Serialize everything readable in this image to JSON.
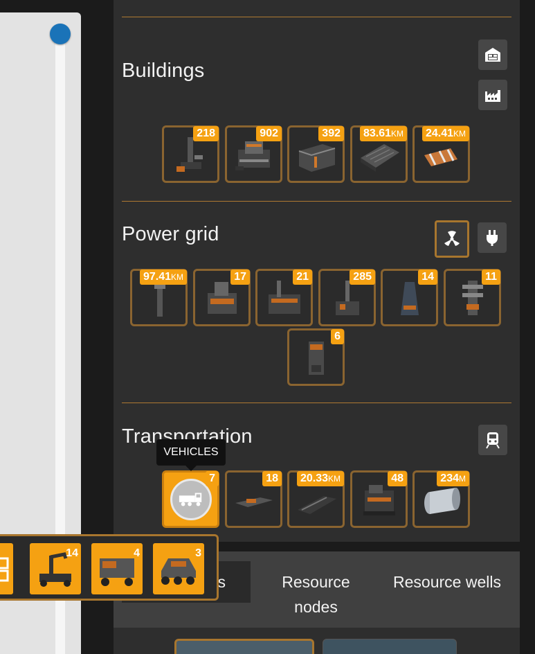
{
  "buildings": {
    "title": "Buildings",
    "icons": [
      "storage-building-icon",
      "factory-icon"
    ],
    "items": [
      {
        "name": "building-item-1",
        "count": "218",
        "unit": ""
      },
      {
        "name": "building-item-2",
        "count": "902",
        "unit": ""
      },
      {
        "name": "building-item-3",
        "count": "392",
        "unit": ""
      },
      {
        "name": "building-item-4",
        "count": "83.61",
        "unit": "KM"
      },
      {
        "name": "building-item-5",
        "count": "24.41",
        "unit": "KM"
      }
    ]
  },
  "power_grid": {
    "title": "Power grid",
    "icons": [
      "radiation-icon",
      "power-plug-icon"
    ],
    "items": [
      {
        "count": "97.41",
        "unit": "KM"
      },
      {
        "count": "17",
        "unit": ""
      },
      {
        "count": "21",
        "unit": ""
      },
      {
        "count": "285",
        "unit": ""
      },
      {
        "count": "14",
        "unit": ""
      },
      {
        "count": "11",
        "unit": ""
      },
      {
        "count": "6",
        "unit": ""
      }
    ]
  },
  "transportation": {
    "title": "Transportation",
    "icons": [
      "train-icon"
    ],
    "tooltip": "VEHICLES",
    "items": [
      {
        "count": "7",
        "unit": ""
      },
      {
        "count": "18",
        "unit": ""
      },
      {
        "count": "20.33",
        "unit": "KM"
      },
      {
        "count": "48",
        "unit": ""
      },
      {
        "count": "234",
        "unit": "M"
      }
    ],
    "submenu": [
      {
        "count": "14"
      },
      {
        "count": "4"
      },
      {
        "count": "3"
      }
    ]
  },
  "tabs": [
    {
      "label": "rs"
    },
    {
      "label": "Resource nodes"
    },
    {
      "label": "Resource wells"
    }
  ],
  "colors": {
    "accent": "#f5a112",
    "border": "#8a6430",
    "panel": "#2e2e2e"
  }
}
